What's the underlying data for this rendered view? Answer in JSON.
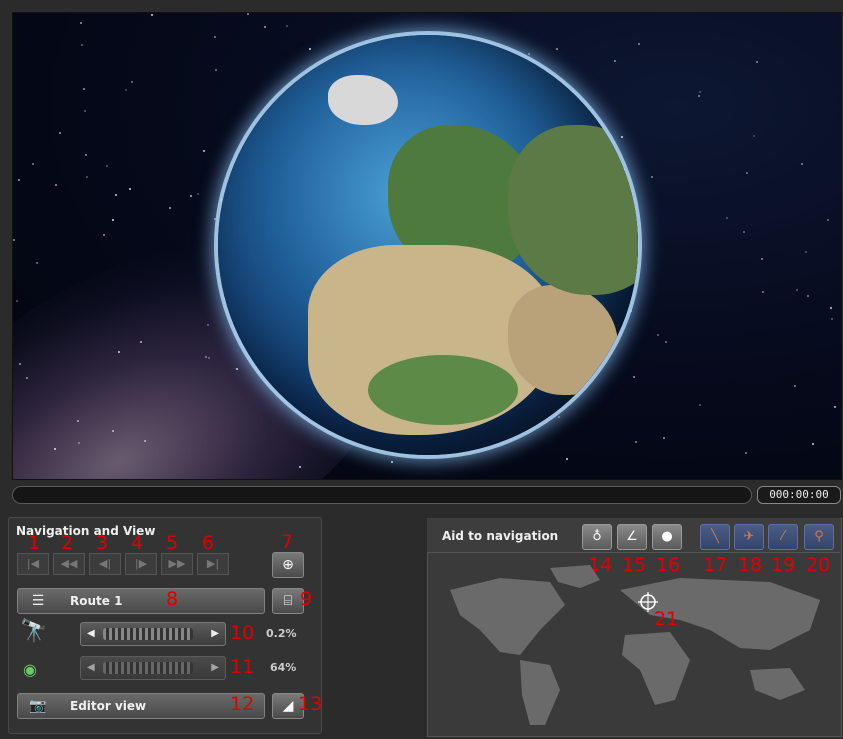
{
  "viewport": {
    "timecode": "000:00:00"
  },
  "navigation_panel": {
    "title": "Navigation and View",
    "playback_buttons": [
      {
        "icon": "skip-to-start-icon",
        "glyph": "|◀",
        "callout": "1"
      },
      {
        "icon": "rewind-icon",
        "glyph": "◀◀",
        "callout": "2"
      },
      {
        "icon": "step-back-icon",
        "glyph": "◀|",
        "callout": "3"
      },
      {
        "icon": "step-forward-icon",
        "glyph": "|▶",
        "callout": "4"
      },
      {
        "icon": "fast-forward-icon",
        "glyph": "▶▶",
        "callout": "5"
      },
      {
        "icon": "skip-to-end-icon",
        "glyph": "▶|",
        "callout": "6"
      }
    ],
    "target_callout": "7",
    "route_label": "Route 1",
    "route_callout": "8",
    "route_side_callout": "9",
    "speed_percent": "0.2%",
    "speed_callout": "10",
    "speed_level": 0.2,
    "opacity_percent": "64%",
    "opacity_callout": "11",
    "opacity_level": 64,
    "view_label": "Editor view",
    "view_callout": "12",
    "view_side_callout": "13"
  },
  "aid_panel": {
    "title": "Aid to navigation",
    "tools": [
      {
        "icon": "compass-north-icon",
        "callout": "14",
        "style": "grey"
      },
      {
        "icon": "angle-icon",
        "callout": "15",
        "style": "grey"
      },
      {
        "icon": "globe-terrain-icon",
        "callout": "16",
        "style": "grey"
      },
      {
        "icon": "ruler-line-icon",
        "callout": "17",
        "style": "blue"
      },
      {
        "icon": "airplane-icon",
        "callout": "18",
        "style": "blue"
      },
      {
        "icon": "pen-icon",
        "callout": "19",
        "style": "blue"
      },
      {
        "icon": "pin-icon",
        "callout": "20",
        "style": "blue"
      }
    ],
    "map_marker_callout": "21"
  },
  "colors": {
    "callout": "#e00000",
    "active_tool": "#3b4d75",
    "background": "#2b2b2b"
  }
}
